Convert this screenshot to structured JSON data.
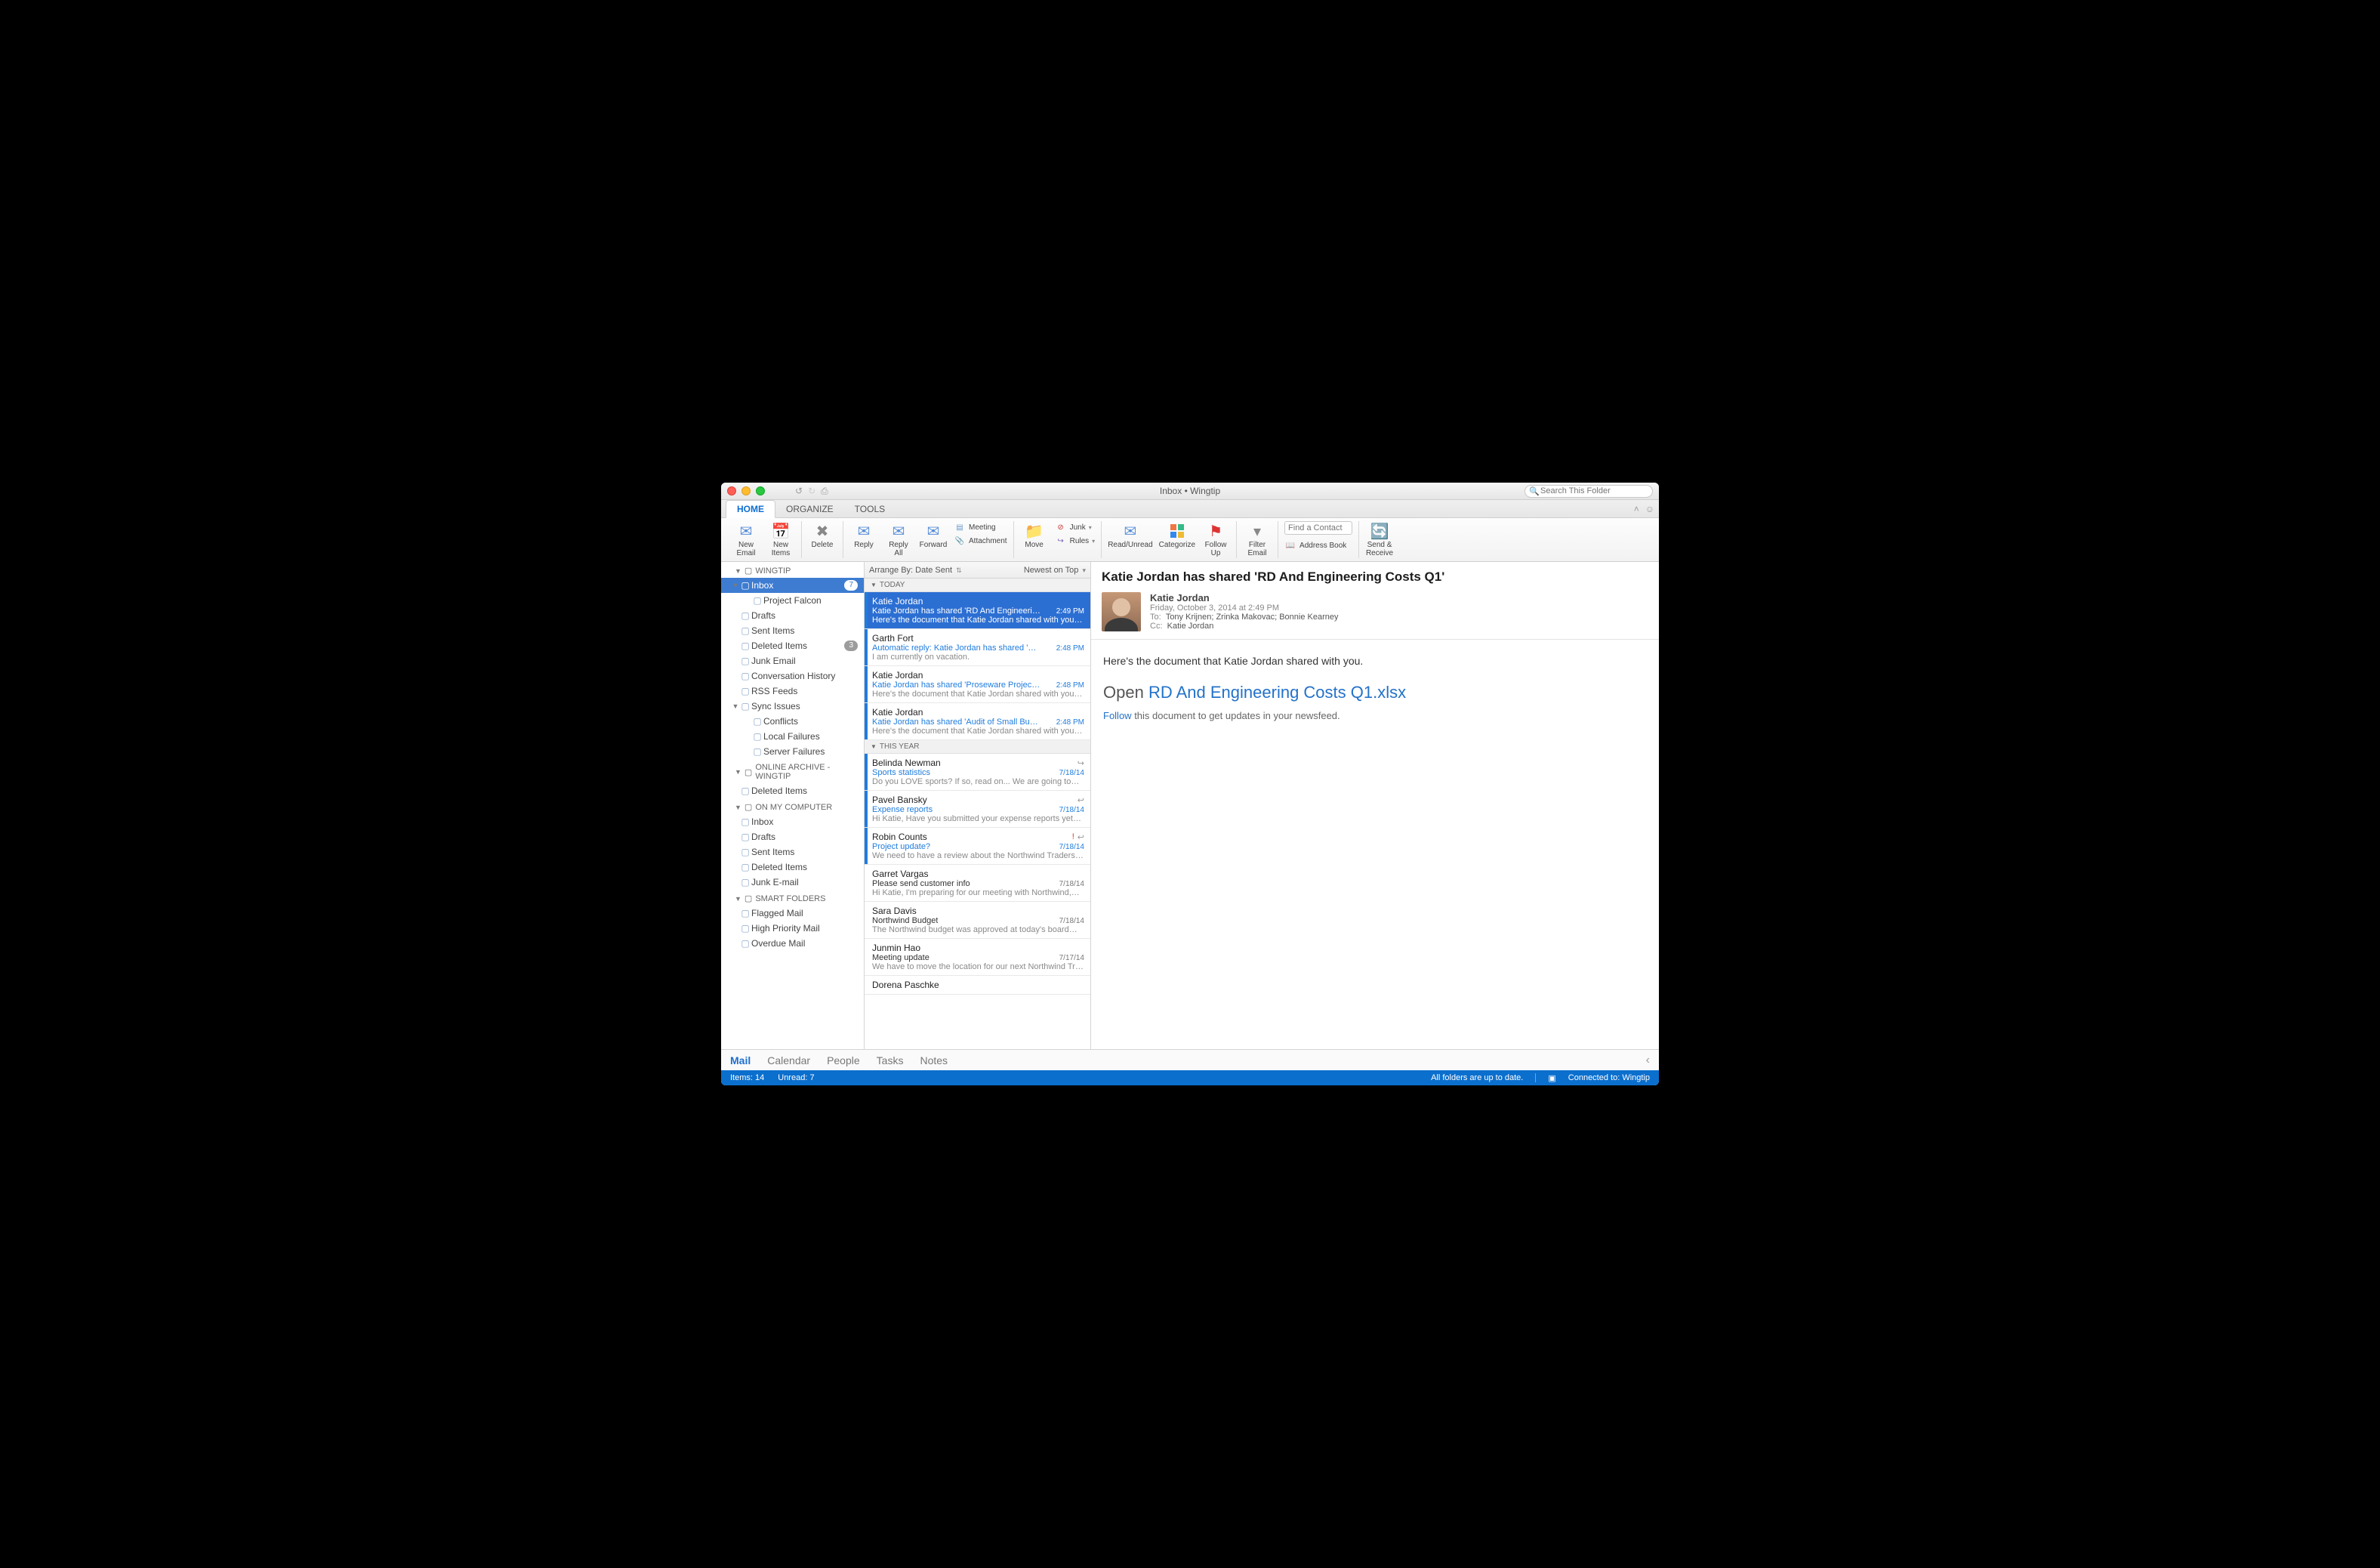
{
  "window": {
    "title": "Inbox • Wingtip"
  },
  "search": {
    "placeholder": "Search This Folder"
  },
  "tabs": {
    "home": "HOME",
    "organize": "ORGANIZE",
    "tools": "TOOLS"
  },
  "ribbon": {
    "new_email": "New\nEmail",
    "new_items": "New\nItems",
    "delete": "Delete",
    "reply": "Reply",
    "reply_all": "Reply\nAll",
    "forward": "Forward",
    "meeting": "Meeting",
    "attachment": "Attachment",
    "move": "Move",
    "junk": "Junk",
    "rules": "Rules",
    "read_unread": "Read/Unread",
    "categorize": "Categorize",
    "follow_up": "Follow\nUp",
    "filter_email": "Filter\nEmail",
    "find_contact_ph": "Find a Contact",
    "address_book": "Address Book",
    "send_receive": "Send &\nReceive"
  },
  "sidebar": {
    "accounts": [
      {
        "name": "WINGTIP",
        "items": [
          {
            "label": "Inbox",
            "badge": "7",
            "selected": true,
            "children": [
              {
                "label": "Project Falcon"
              }
            ]
          },
          {
            "label": "Drafts"
          },
          {
            "label": "Sent Items"
          },
          {
            "label": "Deleted Items",
            "badge": "3"
          },
          {
            "label": "Junk Email"
          },
          {
            "label": "Conversation History"
          },
          {
            "label": "RSS Feeds"
          },
          {
            "label": "Sync Issues",
            "children": [
              {
                "label": "Conflicts"
              },
              {
                "label": "Local Failures"
              },
              {
                "label": "Server Failures"
              }
            ]
          }
        ]
      },
      {
        "name": "Online Archive - Wingtip",
        "items": [
          {
            "label": "Deleted Items"
          }
        ]
      },
      {
        "name": "ON MY COMPUTER",
        "items": [
          {
            "label": "Inbox"
          },
          {
            "label": "Drafts"
          },
          {
            "label": "Sent Items"
          },
          {
            "label": "Deleted Items"
          },
          {
            "label": "Junk E-mail"
          }
        ]
      },
      {
        "name": "SMART FOLDERS",
        "items": [
          {
            "label": "Flagged Mail"
          },
          {
            "label": "High Priority Mail"
          },
          {
            "label": "Overdue Mail"
          }
        ]
      }
    ]
  },
  "list": {
    "arrange_by": "Arrange By: Date Sent",
    "sort": "Newest on Top",
    "groups": [
      {
        "title": "TODAY",
        "messages": [
          {
            "sender": "Katie Jordan",
            "subject": "Katie Jordan has shared 'RD And Engineeri…",
            "preview": "Here's the document that Katie Jordan shared with you…",
            "time": "2:49 PM",
            "unread": true,
            "selected": true
          },
          {
            "sender": "Garth Fort",
            "subject": "Automatic reply: Katie Jordan has shared '…",
            "preview": "I am currently on vacation.",
            "time": "2:48 PM",
            "unread": true
          },
          {
            "sender": "Katie Jordan",
            "subject": "Katie Jordan has shared 'Proseware Projec…",
            "preview": "Here's the document that Katie Jordan shared with you…",
            "time": "2:48 PM",
            "unread": true
          },
          {
            "sender": "Katie Jordan",
            "subject": "Katie Jordan has shared 'Audit of Small Bu…",
            "preview": "Here's the document that Katie Jordan shared with you…",
            "time": "2:48 PM",
            "unread": true
          }
        ]
      },
      {
        "title": "THIS YEAR",
        "messages": [
          {
            "sender": "Belinda Newman",
            "subject": "Sports statistics",
            "preview": "Do you LOVE sports? If so, read on... We are going to…",
            "time": "7/18/14",
            "unread": true,
            "forwarded": true
          },
          {
            "sender": "Pavel Bansky",
            "subject": "Expense reports",
            "preview": "Hi Katie, Have you submitted your expense reports yet…",
            "time": "7/18/14",
            "unread": true,
            "replied": true
          },
          {
            "sender": "Robin Counts",
            "subject": "Project update?",
            "preview": "We need to have a review about the Northwind Traders…",
            "time": "7/18/14",
            "unread": true,
            "important": true,
            "replied": true
          },
          {
            "sender": "Garret Vargas",
            "subject": "Please send customer info",
            "preview": "Hi Katie, I'm preparing for our meeting with Northwind,…",
            "time": "7/18/14",
            "read": true
          },
          {
            "sender": "Sara Davis",
            "subject": "Northwind Budget",
            "preview": "The Northwind budget was approved at today's board…",
            "time": "7/18/14",
            "read": true
          },
          {
            "sender": "Junmin Hao",
            "subject": "Meeting update",
            "preview": "We have to move the location for our next Northwind Tr…",
            "time": "7/17/14",
            "read": true
          },
          {
            "sender": "Dorena Paschke",
            "subject": "",
            "preview": "",
            "time": "",
            "read": true
          }
        ]
      }
    ]
  },
  "reading": {
    "subject": "Katie Jordan has shared 'RD And Engineering Costs Q1'",
    "from": "Katie Jordan",
    "date": "Friday, October 3, 2014 at 2:49 PM",
    "to_label": "To:",
    "to": "Tony Krijnen;   Zrinka Makovac;   Bonnie Kearney",
    "cc_label": "Cc:",
    "cc": "Katie Jordan",
    "body_intro": "Here's the document that Katie Jordan shared with you.",
    "open_word": "Open",
    "doc_link": "RD And Engineering Costs Q1.xlsx",
    "follow_word": "Follow",
    "follow_rest": " this document to get updates in your newsfeed."
  },
  "nav": {
    "mail": "Mail",
    "calendar": "Calendar",
    "people": "People",
    "tasks": "Tasks",
    "notes": "Notes"
  },
  "status": {
    "items": "Items: 14",
    "unread": "Unread: 7",
    "sync": "All folders are up to date.",
    "connected": "Connected to: Wingtip"
  }
}
